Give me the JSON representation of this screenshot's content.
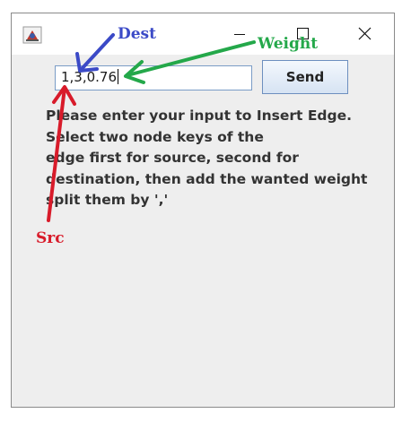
{
  "window": {
    "controls": {
      "minimize_icon": "minimize-icon",
      "maximize_icon": "maximize-icon",
      "close_icon": "close-icon"
    }
  },
  "form": {
    "input_value": "1,3,0.76",
    "send_label": "Send"
  },
  "instruction_lines": [
    "Please enter your input to Insert Edge.",
    "Select two node keys of the",
    "edge first for source, second for",
    "destination, then add the wanted weight",
    "split them by ','"
  ],
  "annotations": {
    "dest": {
      "label": "Dest",
      "color": "#3b4ac7"
    },
    "weight": {
      "label": "Weight",
      "color": "#24a84a"
    },
    "src": {
      "label": "Src",
      "color": "#d81b2a"
    }
  }
}
